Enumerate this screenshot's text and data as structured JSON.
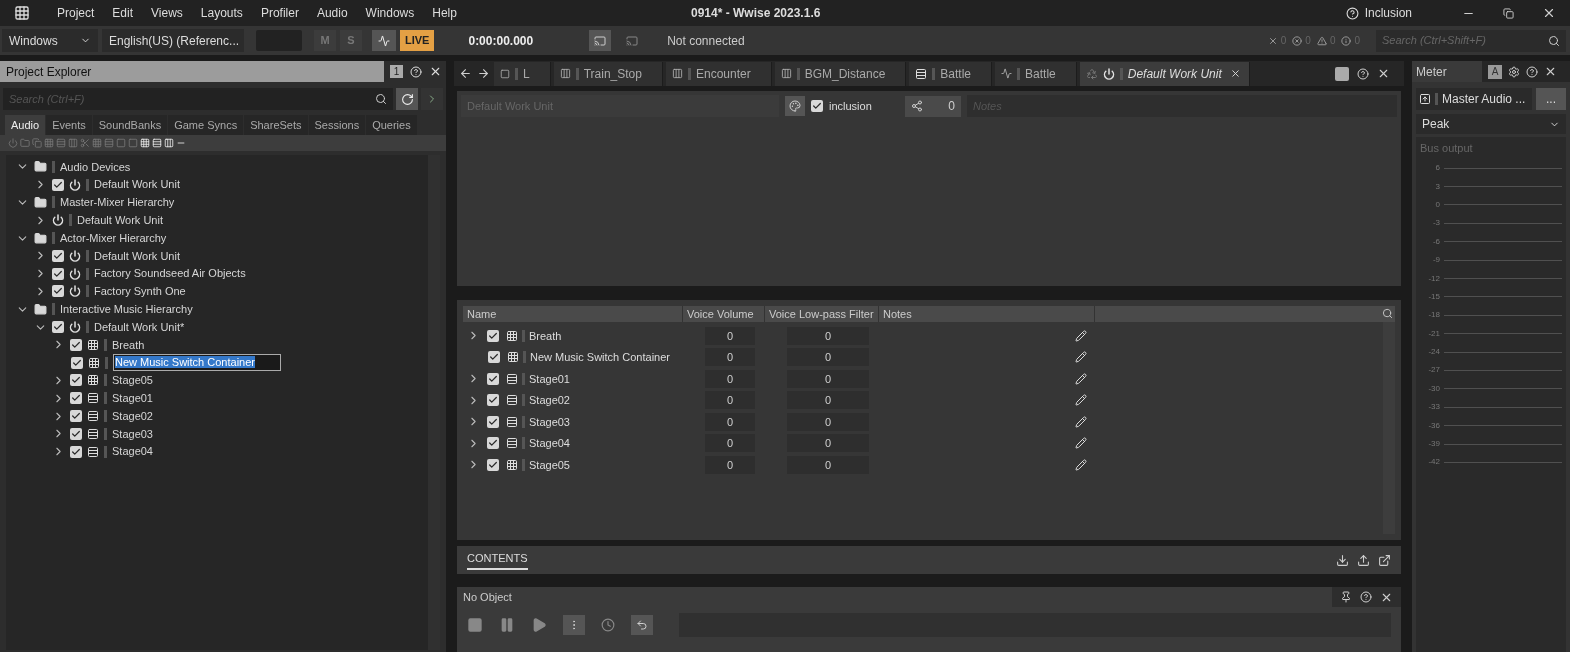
{
  "title_bar": {
    "menu": [
      "Project",
      "Edit",
      "Views",
      "Layouts",
      "Profiler",
      "Audio",
      "Windows",
      "Help"
    ],
    "title": "0914* - Wwise 2023.1.6",
    "user": "Inclusion"
  },
  "toolbar": {
    "platform": "Windows",
    "language": "English(US) (Referenc...",
    "mute": "M",
    "solo": "S",
    "live": "LIVE",
    "live_on": true,
    "time": "0:00:00.000",
    "connection": "Not connected",
    "counts": [
      "0",
      "0",
      "0",
      "0"
    ],
    "search_placeholder": "Search (Ctrl+Shift+F)"
  },
  "project_explorer": {
    "title": "Project Explorer",
    "badge": "1",
    "search_placeholder": "Search (Ctrl+F)",
    "tabs": [
      {
        "label": "Audio",
        "selected": true
      },
      {
        "label": "Events",
        "selected": false
      },
      {
        "label": "SoundBanks",
        "selected": false
      },
      {
        "label": "Game Syncs",
        "selected": false
      },
      {
        "label": "ShareSets",
        "selected": false
      },
      {
        "label": "Sessions",
        "selected": false
      },
      {
        "label": "Queries",
        "selected": false
      }
    ],
    "tree": [
      {
        "label": "Audio Devices",
        "kind": "folder",
        "expanded": true,
        "children": [
          {
            "label": "Default Work Unit",
            "kind": "workunit",
            "expanded": false,
            "checked": true
          }
        ]
      },
      {
        "label": "Master-Mixer Hierarchy",
        "kind": "folder",
        "expanded": true,
        "children": [
          {
            "label": "Default Work Unit",
            "kind": "workunit",
            "expanded": false
          }
        ]
      },
      {
        "label": "Actor-Mixer Hierarchy",
        "kind": "folder",
        "expanded": true,
        "children": [
          {
            "label": "Default Work Unit",
            "kind": "workunit",
            "expanded": false,
            "checked": true
          },
          {
            "label": "Factory Soundseed Air Objects",
            "kind": "workunit",
            "expanded": false,
            "checked": true
          },
          {
            "label": "Factory Synth One",
            "kind": "workunit",
            "expanded": false,
            "checked": true
          }
        ]
      },
      {
        "label": "Interactive Music Hierarchy",
        "kind": "folder",
        "expanded": true,
        "children": [
          {
            "label": "Default Work Unit*",
            "kind": "workunit",
            "expanded": true,
            "checked": true,
            "children": [
              {
                "label": "Breath",
                "kind": "switch",
                "expanded": false,
                "checked": true
              },
              {
                "label": "New Music Switch Container",
                "kind": "switch",
                "checked": true,
                "editing": true
              },
              {
                "label": "Stage05",
                "kind": "switch",
                "expanded": false,
                "checked": true
              },
              {
                "label": "Stage01",
                "kind": "segment",
                "expanded": false,
                "checked": true
              },
              {
                "label": "Stage02",
                "kind": "segment",
                "expanded": false,
                "checked": true
              },
              {
                "label": "Stage03",
                "kind": "segment",
                "expanded": false,
                "checked": true
              },
              {
                "label": "Stage04",
                "kind": "segment",
                "expanded": false,
                "checked": true
              }
            ]
          }
        ]
      }
    ]
  },
  "editor": {
    "tabs": [
      {
        "label": "L",
        "kind": "square",
        "selected": false
      },
      {
        "label": "Train_Stop",
        "kind": "branch",
        "selected": false
      },
      {
        "label": "Encounter",
        "kind": "branch",
        "selected": false
      },
      {
        "label": "BGM_Distance",
        "kind": "branch",
        "selected": false
      },
      {
        "label": "Battle",
        "kind": "segment",
        "selected": false
      },
      {
        "label": "Battle",
        "kind": "half",
        "selected": false
      },
      {
        "label": "Default Work Unit",
        "kind": "workunit",
        "selected": true
      }
    ],
    "name": "Default Work Unit",
    "inclusion_label": "inclusion",
    "inclusion": true,
    "references": "0",
    "notes_placeholder": "Notes",
    "table": {
      "columns": [
        "Name",
        "Voice Volume",
        "Voice Low-pass Filter",
        "Notes"
      ],
      "rows": [
        {
          "name": "Breath",
          "kind": "switch",
          "expanded": false,
          "checked": true,
          "volume": "0",
          "lowpass": "0"
        },
        {
          "name": "New Music Switch Container",
          "kind": "switch",
          "checked": true,
          "volume": "0",
          "lowpass": "0"
        },
        {
          "name": "Stage01",
          "kind": "segment",
          "expanded": false,
          "checked": true,
          "volume": "0",
          "lowpass": "0"
        },
        {
          "name": "Stage02",
          "kind": "segment",
          "expanded": false,
          "checked": true,
          "volume": "0",
          "lowpass": "0"
        },
        {
          "name": "Stage03",
          "kind": "segment",
          "expanded": false,
          "checked": true,
          "volume": "0",
          "lowpass": "0"
        },
        {
          "name": "Stage04",
          "kind": "segment",
          "expanded": false,
          "checked": true,
          "volume": "0",
          "lowpass": "0"
        },
        {
          "name": "Stage05",
          "kind": "switch",
          "expanded": false,
          "checked": true,
          "volume": "0",
          "lowpass": "0"
        }
      ]
    },
    "contents_tab": "CONTENTS"
  },
  "transport": {
    "title": "No Object"
  },
  "meter": {
    "title": "Meter",
    "badge": "A",
    "bus": "Master Audio ...",
    "more": "...",
    "mode": "Peak",
    "label": "Bus output",
    "scale": [
      "6",
      "3",
      "0",
      "-3",
      "-6",
      "-9",
      "-12",
      "-15",
      "-18",
      "-21",
      "-24",
      "-27",
      "-30",
      "-33",
      "-36",
      "-39",
      "-42"
    ]
  }
}
